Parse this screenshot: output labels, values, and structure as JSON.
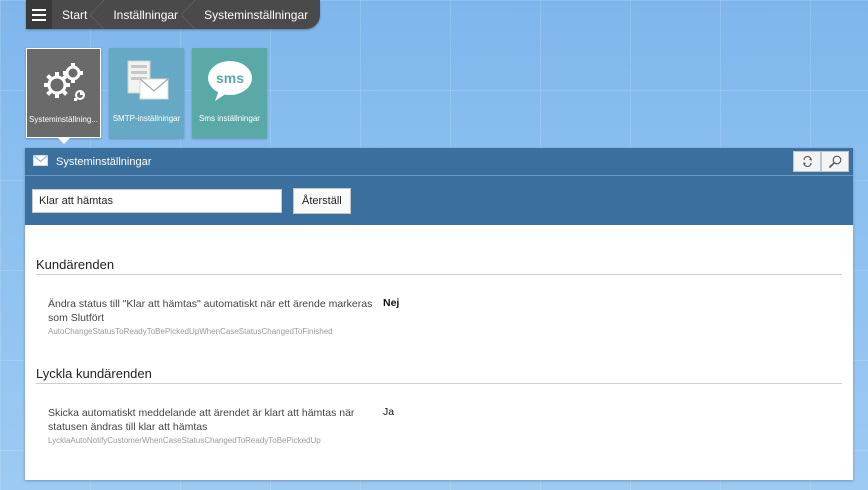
{
  "breadcrumb": [
    "Start",
    "Inställningar",
    "Systeminställningar"
  ],
  "tiles": [
    {
      "label": "Systeminställning...",
      "icon": "gears-icon"
    },
    {
      "label": "SMTP-inställningar",
      "icon": "smtp-server-mail-icon"
    },
    {
      "label": "Sms inställningar",
      "icon": "sms-bubble-icon",
      "icon_text": "sms"
    }
  ],
  "panel": {
    "title": "Systeminställningar",
    "search": {
      "value": "Klar att hämtas",
      "placeholder": ""
    },
    "reset_label": "Återställ"
  },
  "sections": [
    {
      "title": "Kundärenden",
      "settings": [
        {
          "label": "Ändra status till \"Klar att hämtas\" automatiskt när ett ärende markeras som Slutfört",
          "key": "AutoChangeStatusToReadyToBePickedUpWhenCaseStatusChangedToFinished",
          "value": "Nej"
        }
      ]
    },
    {
      "title": "Lyckla kundärenden",
      "settings": [
        {
          "label": "Skicka automatiskt meddelande att ärendet är klart att hämtas när statusen ändras till klar att hämtas",
          "key": "LycklaAutoNotifyCustomerWhenCaseStatusChangedToReadyToBePickedUp",
          "value": "Ja"
        }
      ]
    }
  ],
  "colors": {
    "header": "#3a6f9e",
    "gear_tile": "#6a6a6a",
    "smtp_tile": "#66a9c4",
    "sms_tile": "#5aa9a6"
  }
}
